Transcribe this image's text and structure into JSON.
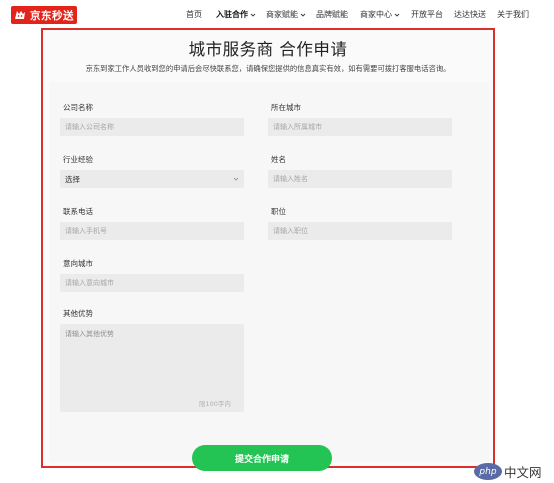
{
  "brand": {
    "name": "京东秒送",
    "color": "#e1251b"
  },
  "nav": {
    "items": [
      {
        "label": "首页",
        "dropdown": false,
        "active": false
      },
      {
        "label": "入驻合作",
        "dropdown": true,
        "active": true
      },
      {
        "label": "商家赋能",
        "dropdown": true,
        "active": false
      },
      {
        "label": "品牌赋能",
        "dropdown": false,
        "active": false
      },
      {
        "label": "商家中心",
        "dropdown": true,
        "active": false
      },
      {
        "label": "开放平台",
        "dropdown": false,
        "active": false
      },
      {
        "label": "达达快送",
        "dropdown": false,
        "active": false
      },
      {
        "label": "关于我们",
        "dropdown": false,
        "active": false
      }
    ]
  },
  "page": {
    "title": "城市服务商 合作申请",
    "subtitle": "京东到家工作人员收到您的申请后会尽快联系您，请确保您提供的信息真实有效，如有需要可拨打客服电话咨询。"
  },
  "form": {
    "company": {
      "label": "公司名称",
      "placeholder": "请输入公司名称",
      "value": ""
    },
    "city": {
      "label": "所在城市",
      "placeholder": "请输入所属城市",
      "value": ""
    },
    "industry": {
      "label": "行业经验",
      "selected": "选择"
    },
    "name": {
      "label": "姓名",
      "placeholder": "请输入姓名",
      "value": ""
    },
    "phone": {
      "label": "联系电话",
      "placeholder": "请输入手机号",
      "value": ""
    },
    "position": {
      "label": "职位",
      "placeholder": "请输入职位",
      "value": ""
    },
    "target_city": {
      "label": "意向城市",
      "placeholder": "请输入意向城市",
      "value": ""
    },
    "advantages": {
      "label": "其他优势",
      "placeholder": "请输入其他优势",
      "counter": "限100字内"
    }
  },
  "submit_label": "提交合作申请",
  "colors": {
    "highlight_border": "#d9302b",
    "submit": "#23c453",
    "input_bg": "#ebebeb"
  },
  "watermark": {
    "mark": "php",
    "text": "中文网"
  }
}
